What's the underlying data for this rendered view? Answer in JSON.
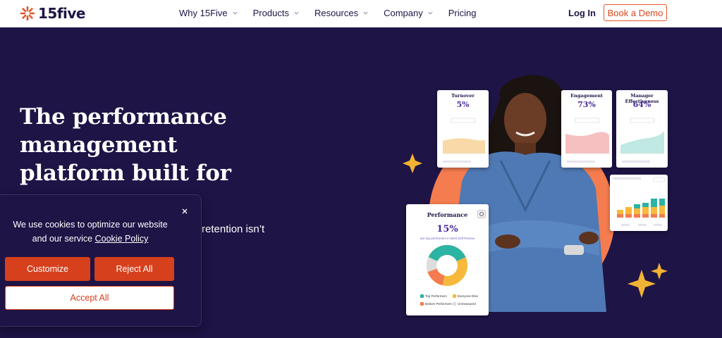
{
  "nav": {
    "brand": "15five",
    "menu": [
      {
        "label": "Why 15Five"
      },
      {
        "label": "Products"
      },
      {
        "label": "Resources"
      },
      {
        "label": "Company"
      },
      {
        "label": "Pricing"
      }
    ],
    "login": "Log In",
    "demo": "Book a Demo"
  },
  "hero": {
    "headline": "The performance management platform built for",
    "subtext_partial": "retention isn’t"
  },
  "cookie": {
    "message": "We use cookies to optimize our website and our service",
    "policy_link": "Cookie Policy",
    "customize": "Customize",
    "reject": "Reject All",
    "accept": "Accept All"
  },
  "dashboard": {
    "turnover": {
      "title": "Turnover",
      "value": "5%"
    },
    "engagement": {
      "title": "Engagement",
      "value": "73%"
    },
    "manager": {
      "title": "Manager Effectiveness",
      "value": "64%"
    },
    "performance": {
      "title": "Performance",
      "value": "15%",
      "caption": "are top performers in Best Self Review",
      "legend": [
        "Top Performers",
        "Everyone Else",
        "Bottom Performers",
        "Unmeasured"
      ]
    }
  },
  "colors": {
    "primary_bg": "#1e1446",
    "accent_orange": "#d6401c",
    "highlight": "#f47c4f",
    "star": "#f2b233"
  }
}
